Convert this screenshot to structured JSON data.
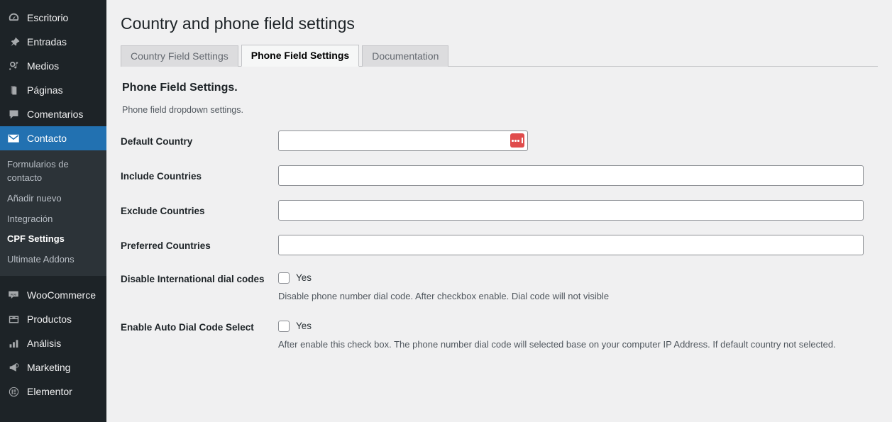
{
  "sidebar": {
    "items": [
      {
        "label": "Escritorio",
        "icon": "dashboard-icon"
      },
      {
        "label": "Entradas",
        "icon": "pin-icon"
      },
      {
        "label": "Medios",
        "icon": "media-icon"
      },
      {
        "label": "Páginas",
        "icon": "pages-icon"
      },
      {
        "label": "Comentarios",
        "icon": "comments-icon"
      },
      {
        "label": "Contacto",
        "icon": "email-icon",
        "current": true
      }
    ],
    "submenu": [
      {
        "label": "Formularios de contacto",
        "active": false
      },
      {
        "label": "Añadir nuevo",
        "active": false
      },
      {
        "label": "Integración",
        "active": false
      },
      {
        "label": "CPF Settings",
        "active": true
      },
      {
        "label": "Ultimate Addons",
        "active": false
      }
    ],
    "items_bottom": [
      {
        "label": "WooCommerce",
        "icon": "woocommerce-icon"
      },
      {
        "label": "Productos",
        "icon": "product-icon"
      },
      {
        "label": "Análisis",
        "icon": "analytics-icon"
      },
      {
        "label": "Marketing",
        "icon": "megaphone-icon"
      },
      {
        "label": "Elementor",
        "icon": "elementor-icon"
      }
    ]
  },
  "header": {
    "title": "Country and phone field settings"
  },
  "tabs": [
    {
      "label": "Country Field Settings",
      "active": false
    },
    {
      "label": "Phone Field Settings",
      "active": true
    },
    {
      "label": "Documentation",
      "active": false
    }
  ],
  "main": {
    "section_title": "Phone Field Settings.",
    "section_desc": "Phone field dropdown settings.",
    "fields": [
      {
        "label": "Default Country",
        "type": "text",
        "value": "",
        "narrow": true,
        "badge": "password-manager-icon"
      },
      {
        "label": "Include Countries",
        "type": "text",
        "value": ""
      },
      {
        "label": "Exclude Countries",
        "type": "text",
        "value": ""
      },
      {
        "label": "Preferred Countries",
        "type": "text",
        "value": ""
      },
      {
        "label": "Disable International dial codes",
        "type": "checkbox",
        "checkbox_label": "Yes",
        "checked": false,
        "help": "Disable phone number dial code. After checkbox enable. Dial code will not visible"
      },
      {
        "label": "Enable Auto Dial Code Select",
        "type": "checkbox",
        "checkbox_label": "Yes",
        "checked": false,
        "help": "After enable this check box. The phone number dial code will selected base on your computer IP Address. If default country not selected."
      }
    ]
  },
  "colors": {
    "sidebar_bg": "#1d2327",
    "submenu_bg": "#2c3338",
    "accent_blue": "#2271b1",
    "content_bg": "#f0f0f1",
    "badge_red": "#e04c4c"
  }
}
